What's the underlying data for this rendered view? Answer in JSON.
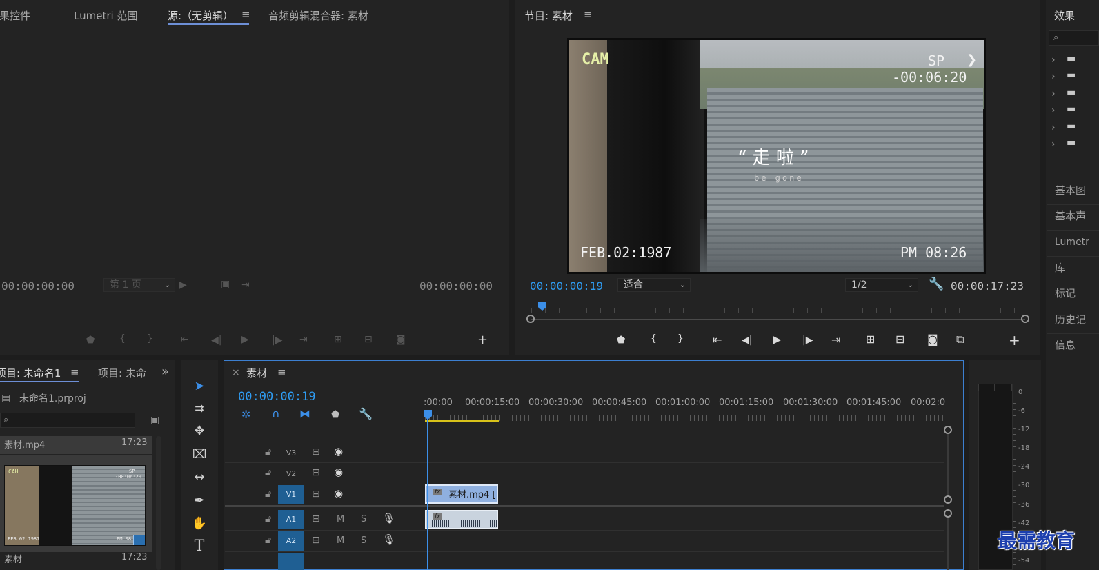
{
  "source_panel": {
    "tabs": [
      "效果控件",
      "Lumetri 范围",
      "源:（无剪辑）",
      "音频剪辑混合器: 素材"
    ],
    "menu_icon": "≡",
    "timecode_left": "00:00:00:00",
    "page_select": "第 1 页",
    "timecode_right": "00:00:00:00"
  },
  "program_panel": {
    "title": "节目: 素材",
    "menu_icon": "≡",
    "timecode_current": "00:00:00:19",
    "fit_select": "适合",
    "resolution_select": "1/2",
    "timecode_duration": "00:00:17:23",
    "overlay": {
      "cam": "CAM",
      "sp": "SP",
      "counter": "-00:06:20",
      "quote": "“ 走 啦 ”",
      "subtitle": "be gone",
      "date": "FEB.02:1987",
      "clock": "PM 08:26"
    }
  },
  "effects_panel": {
    "title": "效果",
    "items": [
      "基本图",
      "基本声",
      "Lumetr",
      "库",
      "标记",
      "历史记",
      "信息"
    ]
  },
  "project_panel": {
    "tab_active": "项目: 未命名1",
    "tab_other": "项目: 未命",
    "menu_icon": "≡",
    "overflow_icon": "»",
    "file_name": "未命名1.prproj",
    "clips": [
      {
        "name": "素材.mp4",
        "duration": "17:23"
      },
      {
        "name": "素材",
        "duration": "17:23"
      }
    ],
    "thumb_cam": "CAH",
    "thumb_sp": "SP",
    "thumb_counter": "-00:06:20",
    "thumb_date": "FEB 02 1987",
    "thumb_clock": "PM 08"
  },
  "timeline": {
    "close_icon": "×",
    "sequence_name": "素材",
    "menu_icon": "≡",
    "timecode": "00:00:00:19",
    "ruler_labels": [
      ":00:00",
      "00:00:15:00",
      "00:00:30:00",
      "00:00:45:00",
      "00:01:00:00",
      "00:01:15:00",
      "00:01:30:00",
      "00:01:45:00",
      "00:02:0"
    ],
    "video_tracks": [
      "V3",
      "V2",
      "V1"
    ],
    "audio_tracks": [
      "A1",
      "A2"
    ],
    "mute_label": "M",
    "solo_label": "S",
    "clip_label": "素材.mp4 [",
    "fx_label": "fx"
  },
  "meter": {
    "labels": [
      "0",
      "-6",
      "-12",
      "-18",
      "-24",
      "-30",
      "-36",
      "-42",
      "-54"
    ]
  },
  "watermark": "最需教育",
  "colors": {
    "accent_blue": "#2f9bf0",
    "track_on": "#1f5f93",
    "clip_video": "#8fb0e0",
    "playhead": "#3c8fe8",
    "work_area": "#d8c21a"
  }
}
